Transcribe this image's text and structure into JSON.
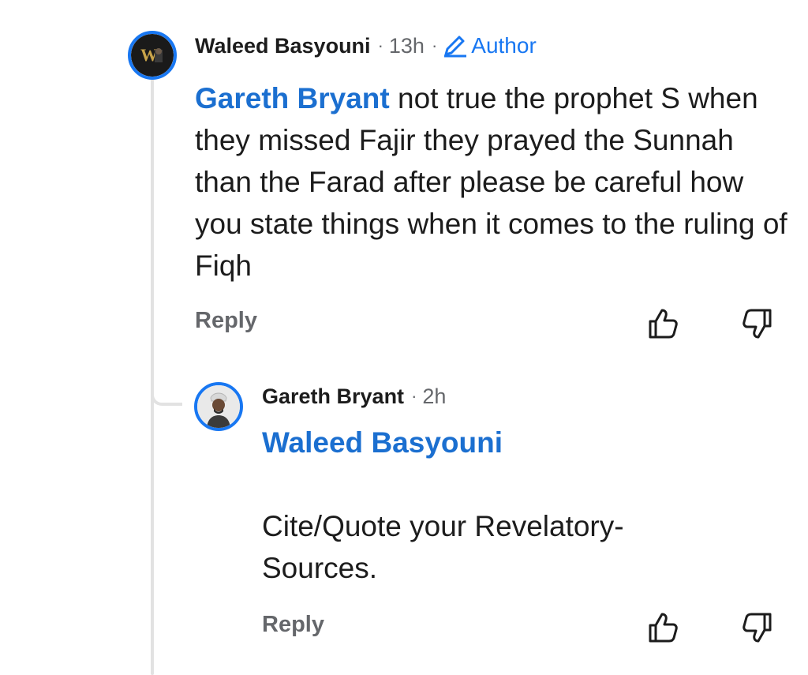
{
  "main_comment": {
    "author": "Waleed Basyouni",
    "time": "13h",
    "badge_label": "Author",
    "badge_icon": "pencil-icon",
    "avatar_icon": "logo-avatar",
    "mention": "Gareth Bryant",
    "text": " not true  the prophet S when they missed Fajir they prayed the Sunnah than the Farad after please be careful how you state things when it comes to the ruling of Fiqh",
    "reply_label": "Reply"
  },
  "reply_comment": {
    "author": "Gareth Bryant",
    "time": "2h",
    "avatar_icon": "person-photo-avatar",
    "mention": "Waleed Basyouni",
    "text": "Cite/Quote your Revelatory-Sources.",
    "reply_label": "Reply"
  },
  "icons": {
    "separator": "·",
    "like": "thumbs-up-icon",
    "dislike": "thumbs-down-icon"
  },
  "colors": {
    "accent": "#1877f2",
    "mention": "#1b6fd0",
    "meta": "#65676b",
    "text": "#1c1c1c",
    "thread_line": "#e2e2e2"
  }
}
